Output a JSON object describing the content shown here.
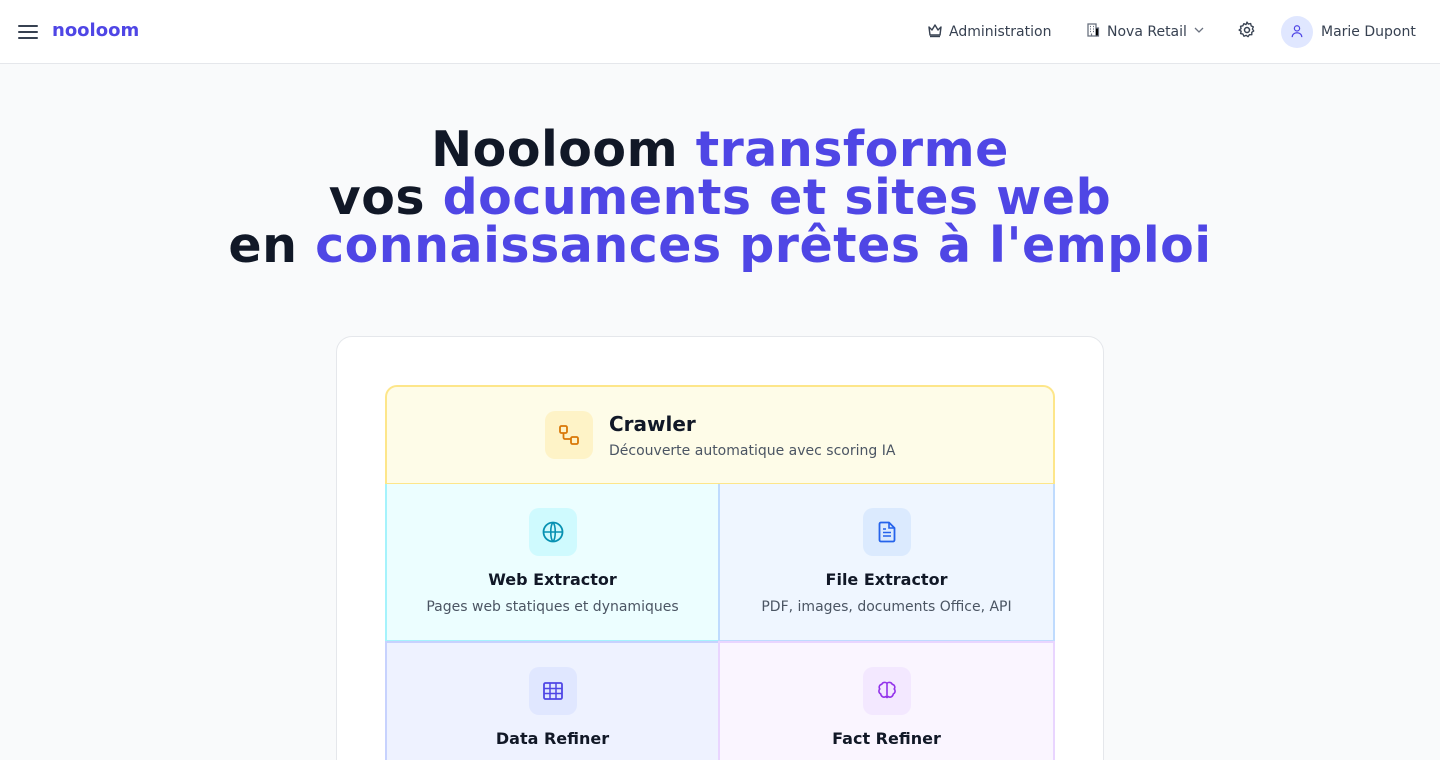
{
  "header": {
    "logo": "nooloom",
    "admin_label": "Administration",
    "org_label": "Nova Retail",
    "user_name": "Marie Dupont"
  },
  "hero": {
    "line1_a": "Nooloom ",
    "line1_b": "transforme",
    "line2_a": "vos ",
    "line2_b": "documents et sites web",
    "line3_a": "en ",
    "line3_b": "connaissances prêtes à l'emploi"
  },
  "crawler": {
    "title": "Crawler",
    "description": "Découverte automatique avec scoring IA",
    "icon": "workflow-icon"
  },
  "tiles": [
    {
      "title": "Web Extractor",
      "description": "Pages web statiques et dynamiques",
      "icon": "globe-icon"
    },
    {
      "title": "File Extractor",
      "description": "PDF, images, documents Office, API",
      "icon": "file-text-icon"
    },
    {
      "title": "Data Refiner",
      "description": "",
      "icon": "table-icon"
    },
    {
      "title": "Fact Refiner",
      "description": "",
      "icon": "brain-icon"
    }
  ],
  "colors": {
    "accent": "#4f46e5",
    "crawler_bg": "#fefce8",
    "web_bg": "#ecfeff",
    "file_bg": "#eff6ff",
    "data_bg": "#eef2ff",
    "fact_bg": "#faf5ff"
  }
}
